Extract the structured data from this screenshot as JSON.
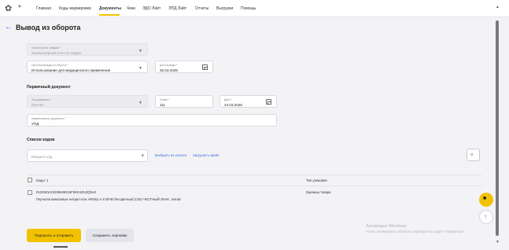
{
  "header": {
    "logo_icon": "lifebuoy-icon",
    "nav": [
      {
        "label": "Главная",
        "active": false
      },
      {
        "label": "Коды маркировки",
        "active": false
      },
      {
        "label": "Документы",
        "active": true
      },
      {
        "label": "Чеки",
        "active": false
      },
      {
        "label": "ЭДО Лайт",
        "active": false
      },
      {
        "label": "ЭПД Лайт",
        "active": false
      },
      {
        "label": "Отчеты",
        "active": false
      },
      {
        "label": "Выгрузки",
        "active": false
      },
      {
        "label": "Помощь",
        "active": false
      }
    ],
    "accent_color": "#f2c200"
  },
  "page": {
    "title": "Вывод из оборота"
  },
  "form": {
    "accounting_method": {
      "label": "Способ учета товаров *",
      "value": "Экземплярный учет по кодам"
    },
    "reason": {
      "label": "Причина вывода из оборота *",
      "value": "Использование для медицинского применения"
    },
    "withdrawal_date": {
      "label": "Дата вывода *",
      "value": "25.03.2026"
    }
  },
  "primary_document": {
    "title": "Первичный документ",
    "doc_type": {
      "label": "Тип документа *",
      "value": "Прочее"
    },
    "number": {
      "label": "Номер *",
      "value": "111"
    },
    "date": {
      "label": "Дата *",
      "value": "24.03.2026"
    },
    "doc_name": {
      "label": "Наименование документа *",
      "value": "УПД"
    }
  },
  "codes": {
    "title": "Список кодов",
    "input_placeholder": "Введите код",
    "select_from_list": "Выбрать из списка",
    "upload_file": "Загрузить файл",
    "table": {
      "col_codes": "Коды: 1",
      "col_package": "Тип упаковки",
      "rows": [
        {
          "code": "0102901410206848215F3KKSZU3QhoX",
          "description": "Перчатки виниловые нитрил-х/эк ARMILLA S NF50 бесцветный (1/10) ЧЕСТНЫЙ ЗНАК , Китай",
          "package": "Единица товара"
        }
      ]
    }
  },
  "actions": {
    "sign_send": "Подписать и отправить",
    "save_draft": "Сохранить черновик"
  },
  "watermark": {
    "line1": "Активация Windows",
    "line2": "Чтобы активировать Windows, перейдите в раздел \"Параметры\"."
  }
}
